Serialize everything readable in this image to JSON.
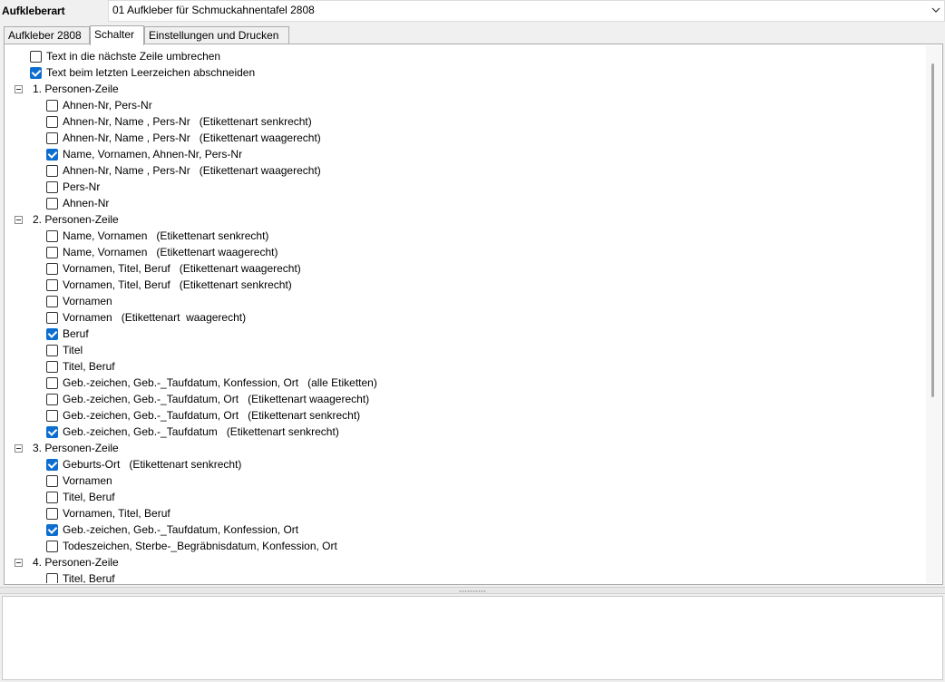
{
  "header": {
    "label": "Aufkleberart",
    "combo_value": "01 Aufkleber für Schmuckahnentafel 2808",
    "combo_icon": "chevron-down-icon"
  },
  "tabs": [
    {
      "label": "Aufkleber 2808",
      "active": false
    },
    {
      "label": "Schalter",
      "active": true
    },
    {
      "label": "Einstellungen und Drucken",
      "active": false
    }
  ],
  "tree": {
    "options": [
      {
        "label": "Text in die nächste Zeile umbrechen",
        "checked": false
      },
      {
        "label": "Text beim letzten Leerzeichen abschneiden",
        "checked": true
      }
    ],
    "groups": [
      {
        "label": "1. Personen-Zeile",
        "expander_icon": "collapse-minus-icon",
        "items": [
          {
            "label": "Ahnen-Nr, Pers-Nr",
            "checked": false
          },
          {
            "label": "Ahnen-Nr, Name , Pers-Nr   (Etikettenart senkrecht)",
            "checked": false
          },
          {
            "label": "Ahnen-Nr, Name , Pers-Nr   (Etikettenart waagerecht)",
            "checked": false
          },
          {
            "label": "Name, Vornamen, Ahnen-Nr, Pers-Nr",
            "checked": true
          },
          {
            "label": "Ahnen-Nr, Name , Pers-Nr   (Etikettenart waagerecht)",
            "checked": false
          },
          {
            "label": "Pers-Nr",
            "checked": false
          },
          {
            "label": "Ahnen-Nr",
            "checked": false
          }
        ]
      },
      {
        "label": "2. Personen-Zeile",
        "expander_icon": "collapse-minus-icon",
        "items": [
          {
            "label": "Name, Vornamen   (Etikettenart senkrecht)",
            "checked": false
          },
          {
            "label": "Name, Vornamen   (Etikettenart waagerecht)",
            "checked": false
          },
          {
            "label": "Vornamen, Titel, Beruf   (Etikettenart waagerecht)",
            "checked": false
          },
          {
            "label": "Vornamen, Titel, Beruf   (Etikettenart senkrecht)",
            "checked": false
          },
          {
            "label": "Vornamen",
            "checked": false
          },
          {
            "label": "Vornamen   (Etikettenart  waagerecht)",
            "checked": false
          },
          {
            "label": "Beruf",
            "checked": true
          },
          {
            "label": "Titel",
            "checked": false
          },
          {
            "label": "Titel, Beruf",
            "checked": false
          },
          {
            "label": "Geb.-zeichen, Geb.-_Taufdatum, Konfession, Ort   (alle Etiketten)",
            "checked": false
          },
          {
            "label": "Geb.-zeichen, Geb.-_Taufdatum, Ort   (Etikettenart waagerecht)",
            "checked": false
          },
          {
            "label": "Geb.-zeichen, Geb.-_Taufdatum, Ort   (Etikettenart senkrecht)",
            "checked": false
          },
          {
            "label": "Geb.-zeichen, Geb.-_Taufdatum   (Etikettenart senkrecht)",
            "checked": true
          }
        ]
      },
      {
        "label": "3. Personen-Zeile",
        "expander_icon": "collapse-minus-icon",
        "items": [
          {
            "label": "Geburts-Ort   (Etikettenart senkrecht)",
            "checked": true
          },
          {
            "label": "Vornamen",
            "checked": false
          },
          {
            "label": "Titel, Beruf",
            "checked": false
          },
          {
            "label": "Vornamen, Titel, Beruf",
            "checked": false
          },
          {
            "label": "Geb.-zeichen, Geb.-_Taufdatum, Konfession, Ort",
            "checked": true
          },
          {
            "label": "Todeszeichen, Sterbe-_Begräbnisdatum, Konfession, Ort",
            "checked": false
          }
        ]
      },
      {
        "label": "4. Personen-Zeile",
        "expander_icon": "collapse-minus-icon",
        "items": [
          {
            "label": "Titel, Beruf",
            "checked": false
          }
        ]
      }
    ]
  }
}
